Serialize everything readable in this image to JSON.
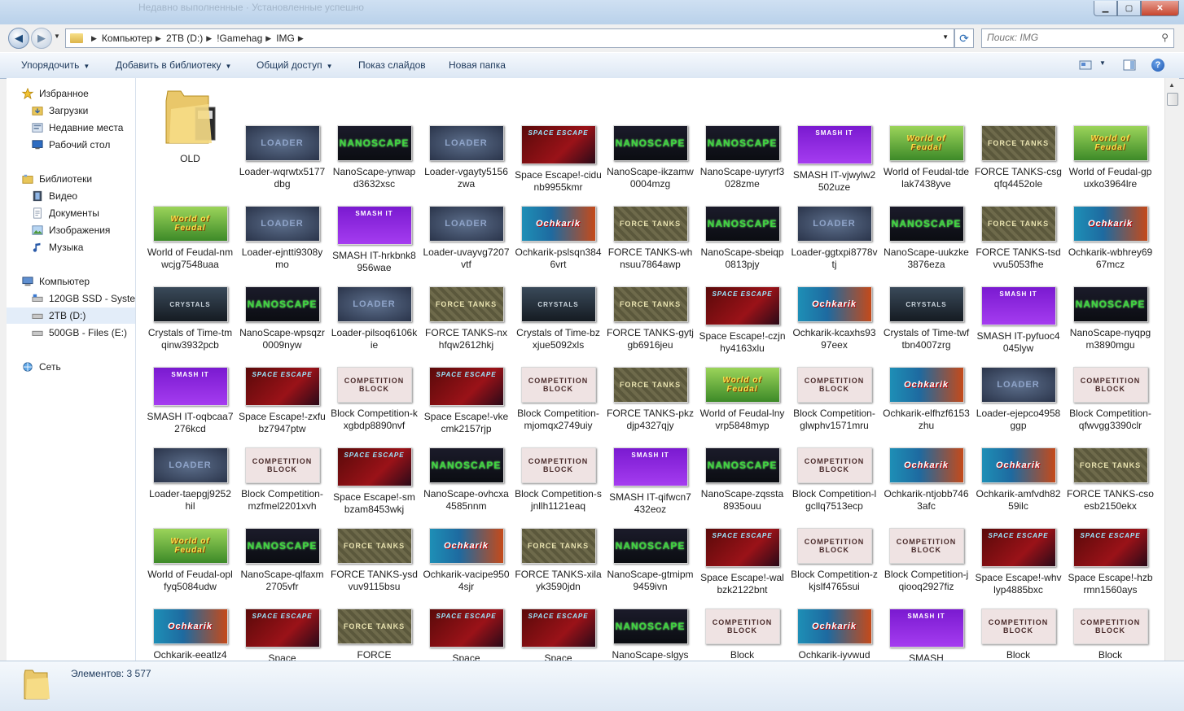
{
  "window": {
    "faded_title": "Недавно выполненные · Установленные успешно"
  },
  "address": {
    "crumbs": [
      "Компьютер",
      "2TB (D:)",
      "!Gamehag",
      "IMG"
    ]
  },
  "search": {
    "placeholder": "Поиск: IMG"
  },
  "toolbar": {
    "organize": "Упорядочить",
    "add_library": "Добавить в библиотеку",
    "share": "Общий доступ",
    "slideshow": "Показ слайдов",
    "new_folder": "Новая папка"
  },
  "nav": {
    "favorites": "Избранное",
    "downloads": "Загрузки",
    "recent": "Недавние места",
    "desktop": "Рабочий стол",
    "libraries": "Библиотеки",
    "video": "Видео",
    "documents": "Документы",
    "images": "Изображения",
    "music": "Музыка",
    "computer": "Компьютер",
    "drive_c": "120GB SSD - System",
    "drive_d": "2TB (D:)",
    "drive_e": "500GB - Files (E:)",
    "network": "Сеть"
  },
  "folder": {
    "name": "OLD"
  },
  "files": [
    {
      "name": "Loader-wqrwtx5177dbg",
      "art": "loader",
      "label": "LOADER"
    },
    {
      "name": "NanoScape-ynwapd3632xsc",
      "art": "nano",
      "label": "NANOSCAPE"
    },
    {
      "name": "Loader-vgayty5156zwa",
      "art": "loader",
      "label": "LOADER"
    },
    {
      "name": "Space Escape!-cidunb9955kmr",
      "art": "space",
      "label": "SPACE ESCAPE"
    },
    {
      "name": "NanoScape-ikzamw0004mzg",
      "art": "nano",
      "label": "NANOSCAPE"
    },
    {
      "name": "NanoScape-uyryrf3028zme",
      "art": "nano",
      "label": "NANOSCAPE"
    },
    {
      "name": "SMASH IT-vjwylw2502uze",
      "art": "smash",
      "label": "SMASH IT"
    },
    {
      "name": "World of Feudal-tdelak7438yve",
      "art": "world",
      "label": "World of Feudal"
    },
    {
      "name": "FORCE TANKS-csgqfq4452ole",
      "art": "force",
      "label": "FORCE TANKS"
    },
    {
      "name": "World of Feudal-gpuxko3964lre",
      "art": "world",
      "label": "World of Feudal"
    },
    {
      "name": "World of Feudal-nmwcjg7548uaa",
      "art": "world",
      "label": "World of Feudal"
    },
    {
      "name": "Loader-ejntti9308ymo",
      "art": "loader",
      "label": "LOADER"
    },
    {
      "name": "SMASH IT-hrkbnk8956wae",
      "art": "smash",
      "label": "SMASH IT"
    },
    {
      "name": "Loader-uvayvg7207vtf",
      "art": "loader",
      "label": "LOADER"
    },
    {
      "name": "Ochkarik-pslsqn3846vrt",
      "art": "och",
      "label": "Ochkarik"
    },
    {
      "name": "FORCE TANKS-whnsuu7864awp",
      "art": "force",
      "label": "FORCE TANKS"
    },
    {
      "name": "NanoScape-sbeiqp0813pjy",
      "art": "nano",
      "label": "NANOSCAPE"
    },
    {
      "name": "Loader-ggtxpi8778vtj",
      "art": "loader",
      "label": "LOADER"
    },
    {
      "name": "NanoScape-uukzke3876eza",
      "art": "nano",
      "label": "NANOSCAPE"
    },
    {
      "name": "FORCE TANKS-tsdvvu5053fhe",
      "art": "force",
      "label": "FORCE TANKS"
    },
    {
      "name": "Ochkarik-wbhrey6967mcz",
      "art": "och",
      "label": "Ochkarik"
    },
    {
      "name": "Crystals of Time-tmqinw3932pcb",
      "art": "crys",
      "label": "CRYSTALS"
    },
    {
      "name": "NanoScape-wpsqzr0009nyw",
      "art": "nano",
      "label": "NANOSCAPE"
    },
    {
      "name": "Loader-pilsoq6106kie",
      "art": "loader",
      "label": "LOADER"
    },
    {
      "name": "FORCE TANKS-nxhfqw2612hkj",
      "art": "force",
      "label": "FORCE TANKS"
    },
    {
      "name": "Crystals of Time-bzxjue5092xls",
      "art": "crys",
      "label": "CRYSTALS"
    },
    {
      "name": "FORCE TANKS-gytjgb6916jeu",
      "art": "force",
      "label": "FORCE TANKS"
    },
    {
      "name": "Space Escape!-czjnhy4163xlu",
      "art": "space",
      "label": "SPACE ESCAPE"
    },
    {
      "name": "Ochkarik-kcaxhs9397eex",
      "art": "och",
      "label": "Ochkarik"
    },
    {
      "name": "Crystals of Time-twftbn4007zrg",
      "art": "crys",
      "label": "CRYSTALS"
    },
    {
      "name": "SMASH IT-pyfuoc4045lyw",
      "art": "smash",
      "label": "SMASH IT"
    },
    {
      "name": "NanoScape-nyqpgm3890mgu",
      "art": "nano",
      "label": "NANOSCAPE"
    },
    {
      "name": "SMASH IT-oqbcaa7276kcd",
      "art": "smash",
      "label": "SMASH IT"
    },
    {
      "name": "Space Escape!-zxfubz7947ptw",
      "art": "space",
      "label": "SPACE ESCAPE"
    },
    {
      "name": "Block Competition-kxgbdp8890nvf",
      "art": "block",
      "label": "COMPETITION BLOCK"
    },
    {
      "name": "Space Escape!-vkecmk2157rjp",
      "art": "space",
      "label": "SPACE ESCAPE"
    },
    {
      "name": "Block Competition-mjomqx2749uiy",
      "art": "block",
      "label": "COMPETITION BLOCK"
    },
    {
      "name": "FORCE TANKS-pkzdjp4327qjy",
      "art": "force",
      "label": "FORCE TANKS"
    },
    {
      "name": "World of Feudal-lnyvrp5848myp",
      "art": "world",
      "label": "World of Feudal"
    },
    {
      "name": "Block Competition-glwphv1571mru",
      "art": "block",
      "label": "COMPETITION BLOCK"
    },
    {
      "name": "Ochkarik-elfhzf6153zhu",
      "art": "och",
      "label": "Ochkarik"
    },
    {
      "name": "Loader-ejepco4958ggp",
      "art": "loader",
      "label": "LOADER"
    },
    {
      "name": "Block Competition-qfwvgg3390clr",
      "art": "block",
      "label": "COMPETITION BLOCK"
    },
    {
      "name": "Loader-taepgj9252hil",
      "art": "loader",
      "label": "LOADER"
    },
    {
      "name": "Block Competition-mzfmel2201xvh",
      "art": "block",
      "label": "COMPETITION BLOCK"
    },
    {
      "name": "Space Escape!-smbzam8453wkj",
      "art": "space",
      "label": "SPACE ESCAPE"
    },
    {
      "name": "NanoScape-ovhcxa4585nnm",
      "art": "nano",
      "label": "NANOSCAPE"
    },
    {
      "name": "Block Competition-sjnllh1121eaq",
      "art": "block",
      "label": "COMPETITION BLOCK"
    },
    {
      "name": "SMASH IT-qifwcn7432eoz",
      "art": "smash",
      "label": "SMASH IT"
    },
    {
      "name": "NanoScape-zqssta8935ouu",
      "art": "nano",
      "label": "NANOSCAPE"
    },
    {
      "name": "Block Competition-lgcllq7513ecp",
      "art": "block",
      "label": "COMPETITION BLOCK"
    },
    {
      "name": "Ochkarik-ntjobb7463afc",
      "art": "och",
      "label": "Ochkarik"
    },
    {
      "name": "Ochkarik-amfvdh8259ilc",
      "art": "och",
      "label": "Ochkarik"
    },
    {
      "name": "FORCE TANKS-csoesb2150ekx",
      "art": "force",
      "label": "FORCE TANKS"
    },
    {
      "name": "World of Feudal-oplfyq5084udw",
      "art": "world",
      "label": "World of Feudal"
    },
    {
      "name": "NanoScape-qlfaxm2705vfr",
      "art": "nano",
      "label": "NANOSCAPE"
    },
    {
      "name": "FORCE TANKS-ysdvuv9115bsu",
      "art": "force",
      "label": "FORCE TANKS"
    },
    {
      "name": "Ochkarik-vacipe9504sjr",
      "art": "och",
      "label": "Ochkarik"
    },
    {
      "name": "FORCE TANKS-xilayk3590jdn",
      "art": "force",
      "label": "FORCE TANKS"
    },
    {
      "name": "NanoScape-gtmipm9459ivn",
      "art": "nano",
      "label": "NANOSCAPE"
    },
    {
      "name": "Space Escape!-walbzk2122bnt",
      "art": "space",
      "label": "SPACE ESCAPE"
    },
    {
      "name": "Block Competition-zkjslf4765sui",
      "art": "block",
      "label": "COMPETITION BLOCK"
    },
    {
      "name": "Block Competition-jqiooq2927fiz",
      "art": "block",
      "label": "COMPETITION BLOCK"
    },
    {
      "name": "Space Escape!-whvlyp4885bxc",
      "art": "space",
      "label": "SPACE ESCAPE"
    },
    {
      "name": "Space Escape!-hzbrmn1560ays",
      "art": "space",
      "label": "SPACE ESCAPE"
    },
    {
      "name": "Ochkarik-eeatlz4",
      "art": "och",
      "label": "Ochkarik"
    },
    {
      "name": "Space",
      "art": "space",
      "label": "SPACE ESCAPE"
    },
    {
      "name": "FORCE",
      "art": "force",
      "label": "FORCE TANKS"
    },
    {
      "name": "Space",
      "art": "space",
      "label": "SPACE ESCAPE"
    },
    {
      "name": "Space",
      "art": "space",
      "label": "SPACE ESCAPE"
    },
    {
      "name": "NanoScape-slgys",
      "art": "nano",
      "label": "NANOSCAPE"
    },
    {
      "name": "Block",
      "art": "block",
      "label": "COMPETITION BLOCK"
    },
    {
      "name": "Ochkarik-iyvwud",
      "art": "och",
      "label": "Ochkarik"
    },
    {
      "name": "SMASH",
      "art": "smash",
      "label": "SMASH IT"
    },
    {
      "name": "Block",
      "art": "block",
      "label": "COMPETITION BLOCK"
    },
    {
      "name": "Block",
      "art": "block",
      "label": "COMPETITION BLOCK"
    }
  ],
  "status": {
    "item_count": "Элементов: 3 577"
  }
}
